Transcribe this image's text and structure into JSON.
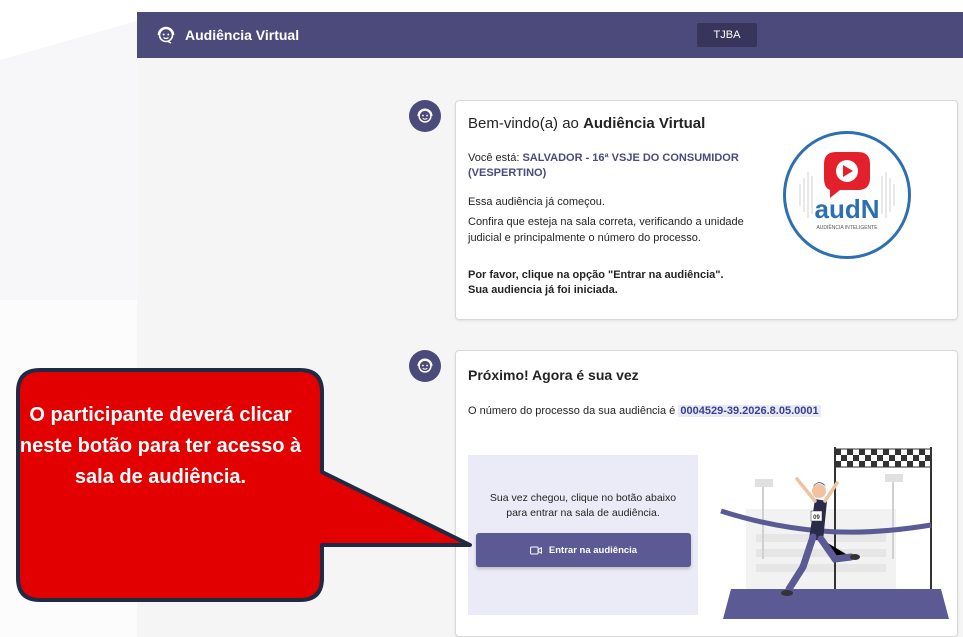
{
  "header": {
    "app_title": "Audiência Virtual",
    "org_badge": "TJBA"
  },
  "welcome_card": {
    "greeting_prefix": "Bem-vindo(a) ao",
    "greeting_app": "Audiência Virtual",
    "location_prefix": "Você está:",
    "location_value": "SALVADOR - 16ª VSJE DO CONSUMIDOR (VESPERTINO)",
    "status": "Essa audiência já começou.",
    "confirm_text": "Confira que esteja na sala correta, verificando a unidade judicial e principalmente o número do processo.",
    "please_text": "Por favor, clique na opção \"Entrar na audiência\". Sua audiencia já foi iniciada.",
    "logo_text": "audN",
    "logo_subtext": "AUDIÊNCIA INTELIGENTE"
  },
  "turn_card": {
    "title": "Próximo! Agora é sua vez",
    "process_prefix": "O número do processo da sua audiência é",
    "process_number": "0004529-39.2026.8.05.0001",
    "panel_text": "Sua vez chegou, clique no botão abaixo para entrar na sala de audiência.",
    "enter_button": "Entrar na audiência",
    "runner_bib": "09"
  },
  "callout": {
    "text": "O participante deverá clicar neste botão para ter acesso à sala de audiência.",
    "fill": "#e30000",
    "stroke": "#1f2a44"
  },
  "colors": {
    "header_bg": "#4c4a7a",
    "button_bg": "#5b5a94",
    "panel_bg": "#ebebf7"
  }
}
